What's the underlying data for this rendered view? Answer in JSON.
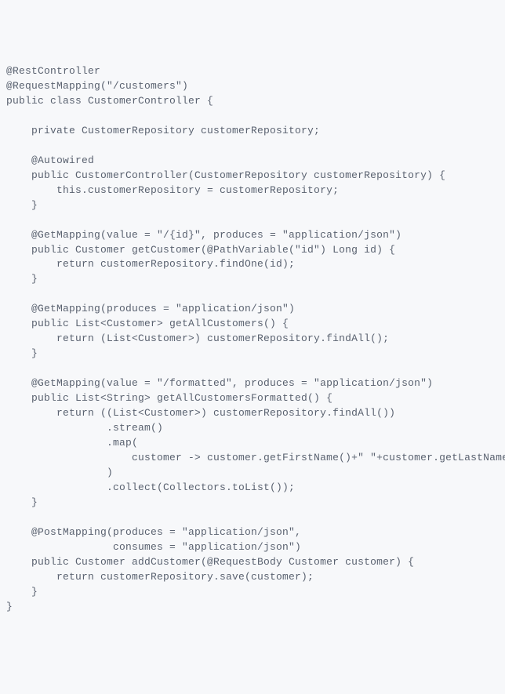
{
  "code": {
    "lines": [
      "@RestController",
      "@RequestMapping(\"/customers\")",
      "public class CustomerController {",
      "",
      "    private CustomerRepository customerRepository;",
      "",
      "    @Autowired",
      "    public CustomerController(CustomerRepository customerRepository) {",
      "        this.customerRepository = customerRepository;",
      "    }",
      "",
      "    @GetMapping(value = \"/{id}\", produces = \"application/json\")",
      "    public Customer getCustomer(@PathVariable(\"id\") Long id) {",
      "        return customerRepository.findOne(id);",
      "    }",
      "",
      "    @GetMapping(produces = \"application/json\")",
      "    public List<Customer> getAllCustomers() {",
      "        return (List<Customer>) customerRepository.findAll();",
      "    }",
      "",
      "    @GetMapping(value = \"/formatted\", produces = \"application/json\")",
      "    public List<String> getAllCustomersFormatted() {",
      "        return ((List<Customer>) customerRepository.findAll())",
      "                .stream()",
      "                .map(",
      "                    customer -> customer.getFirstName()+\" \"+customer.getLastName()",
      "                )",
      "                .collect(Collectors.toList());",
      "    }",
      "",
      "    @PostMapping(produces = \"application/json\",",
      "                 consumes = \"application/json\")",
      "    public Customer addCustomer(@RequestBody Customer customer) {",
      "        return customerRepository.save(customer);",
      "    }",
      "}"
    ]
  }
}
